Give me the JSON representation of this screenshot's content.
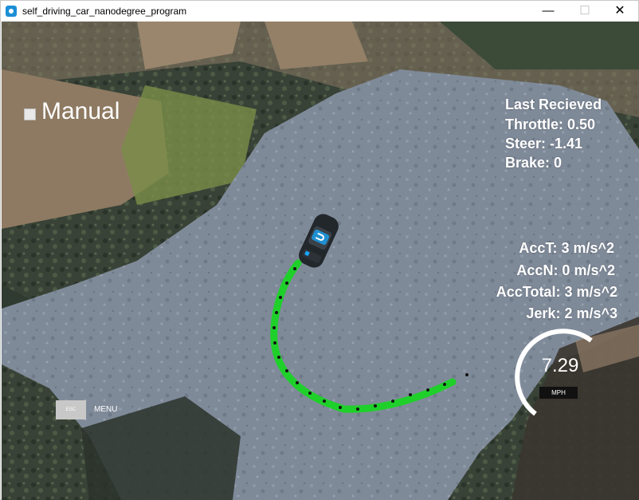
{
  "window": {
    "title": "self_driving_car_nanodegree_program",
    "minimize_symbol": "—",
    "maximize_symbol": "☐",
    "close_symbol": "✕"
  },
  "hud": {
    "mode_label": "Manual",
    "last_received": "Last Recieved",
    "throttle": "Throttle: 0.50",
    "steer": "Steer: -1.41",
    "brake": "Brake: 0",
    "acc_t": "AccT: 3 m/s^2",
    "acc_n": "AccN: 0 m/s^2",
    "acc_total": "AccTotal: 3 m/s^2",
    "jerk": "Jerk: 2 m/s^3",
    "speed": "7.29",
    "speed_unit": "MPH",
    "speed_fraction": 0.35,
    "esc_label": "ESC",
    "menu_label": "MENU"
  },
  "colors": {
    "path": "#1fd02a",
    "ground": "#7c8796",
    "ground_dark": "#3f4a4e",
    "sand": "#8e7a62"
  }
}
